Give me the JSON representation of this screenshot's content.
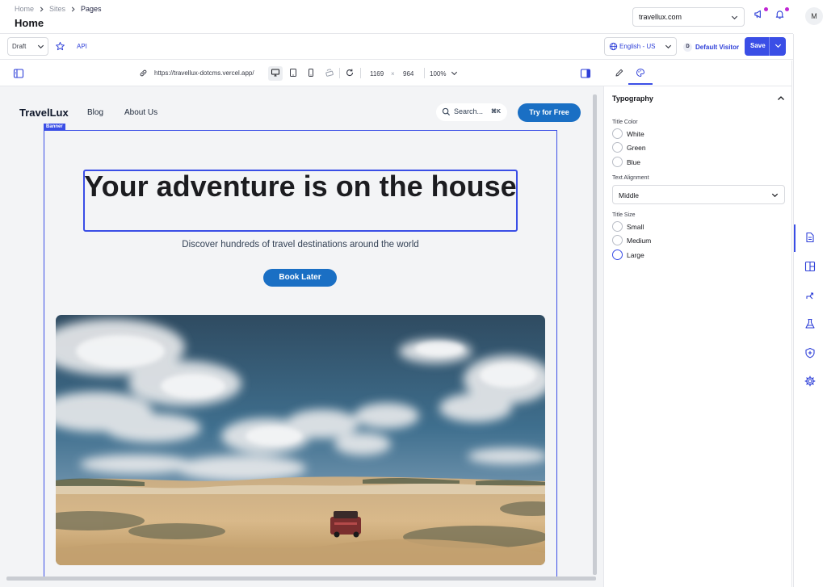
{
  "breadcrumb": [
    "Home",
    "Sites",
    "Pages"
  ],
  "page_title": "Home",
  "site_selector": {
    "value": "travellux.com"
  },
  "toolbar": {
    "status": "Draft",
    "api_label": "API",
    "language": "English - US",
    "visitor_initial": "D",
    "visitor": "Default Visitor",
    "save_label": "Save"
  },
  "user_initial": "M",
  "preview_bar": {
    "url": "https://travellux-dotcms.vercel.app/",
    "width": "1169",
    "times": "×",
    "height": "964",
    "zoom": "100%"
  },
  "site": {
    "logo": "TravelLux",
    "nav": [
      "Blog",
      "About Us"
    ],
    "search_placeholder": "Search...",
    "search_shortcut": "⌘K",
    "cta": "Try for Free",
    "banner_tag": "Banner",
    "hero_title": "Your adventure is on the house",
    "hero_subtitle": "Discover hundreds of travel destinations around the world",
    "hero_button": "Book Later"
  },
  "panel": {
    "section": "Typography",
    "title_color_label": "Title Color",
    "title_color_options": [
      "White",
      "Green",
      "Blue"
    ],
    "alignment_label": "Text Alignment",
    "alignment_value": "Middle",
    "title_size_label": "Title Size",
    "title_size_options": [
      "Small",
      "Medium",
      "Large"
    ]
  },
  "colors": {
    "accent": "#3a4ee6",
    "site_primary": "#1a6fc4",
    "notification_dot": "#c026d3"
  },
  "icons": [
    "chevron-right-icon",
    "chevron-down-icon",
    "megaphone-icon",
    "bell-icon",
    "star-icon",
    "globe-icon",
    "sidebar-toggle-icon",
    "link-icon",
    "desktop-icon",
    "tablet-icon",
    "mobile-icon",
    "rotate-icon",
    "refresh-icon",
    "pencil-icon",
    "palette-icon",
    "chevron-up-icon",
    "document-icon",
    "layout-icon",
    "experiments-icon",
    "flask-icon",
    "shield-icon",
    "gear-icon",
    "search-icon"
  ]
}
